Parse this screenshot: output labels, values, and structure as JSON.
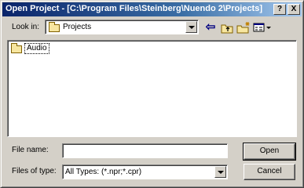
{
  "window": {
    "title": "Open Project - [C:\\Program Files\\Steinberg\\Nuendo 2\\Projects]",
    "help_label": "?",
    "close_label": "X"
  },
  "look_in": {
    "label": "Look in:",
    "value": "Projects",
    "icon": "folder-icon"
  },
  "toolbar": {
    "back_icon": "back-arrow-icon",
    "up_icon": "up-folder-icon",
    "new_folder_icon": "new-folder-icon",
    "view_menu_icon": "view-menu-icon",
    "back_glyph": "⇦"
  },
  "file_list": {
    "items": [
      {
        "label": "Audio",
        "icon": "folder-icon"
      }
    ]
  },
  "file_name": {
    "label": "File name:",
    "value": ""
  },
  "file_type": {
    "label": "Files of type:",
    "value": "All Types: (*.npr;*.cpr)"
  },
  "buttons": {
    "open": "Open",
    "cancel": "Cancel"
  }
}
